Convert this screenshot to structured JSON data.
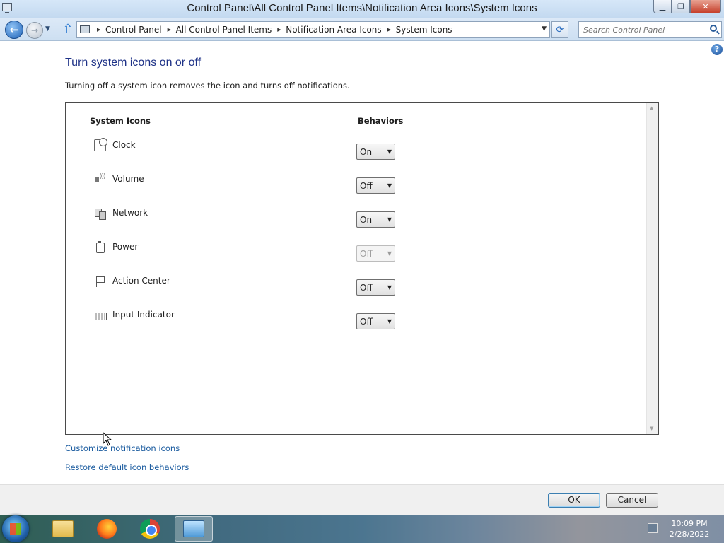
{
  "window": {
    "title": "Control Panel\\All Control Panel Items\\Notification Area Icons\\System Icons",
    "buttons": {
      "minimize": "▁",
      "maximize": "❐",
      "close": "✕"
    }
  },
  "navigation": {
    "breadcrumbs": [
      "Control Panel",
      "All Control Panel Items",
      "Notification Area Icons",
      "System Icons"
    ],
    "search_placeholder": "Search Control Panel"
  },
  "content": {
    "title": "Turn system icons on or off",
    "description": "Turning off a system icon removes the icon and turns off notifications.",
    "columns": {
      "icons": "System Icons",
      "behaviors": "Behaviors"
    },
    "items": [
      {
        "name": "Clock",
        "behavior": "On",
        "enabled": true,
        "icon": "clock-icon"
      },
      {
        "name": "Volume",
        "behavior": "Off",
        "enabled": true,
        "icon": "volume-icon"
      },
      {
        "name": "Network",
        "behavior": "On",
        "enabled": true,
        "icon": "network-icon"
      },
      {
        "name": "Power",
        "behavior": "Off",
        "enabled": false,
        "icon": "power-icon"
      },
      {
        "name": "Action Center",
        "behavior": "Off",
        "enabled": true,
        "icon": "action-center-flag-icon"
      },
      {
        "name": "Input Indicator",
        "behavior": "Off",
        "enabled": true,
        "icon": "keyboard-icon"
      }
    ],
    "links": {
      "customize": "Customize notification icons",
      "restore": "Restore default icon behaviors"
    }
  },
  "footer": {
    "ok": "OK",
    "cancel": "Cancel"
  },
  "taskbar": {
    "apps": [
      "windows-explorer",
      "firefox",
      "chrome",
      "control-panel"
    ],
    "time": "10:09 PM",
    "date": "2/28/2022"
  }
}
